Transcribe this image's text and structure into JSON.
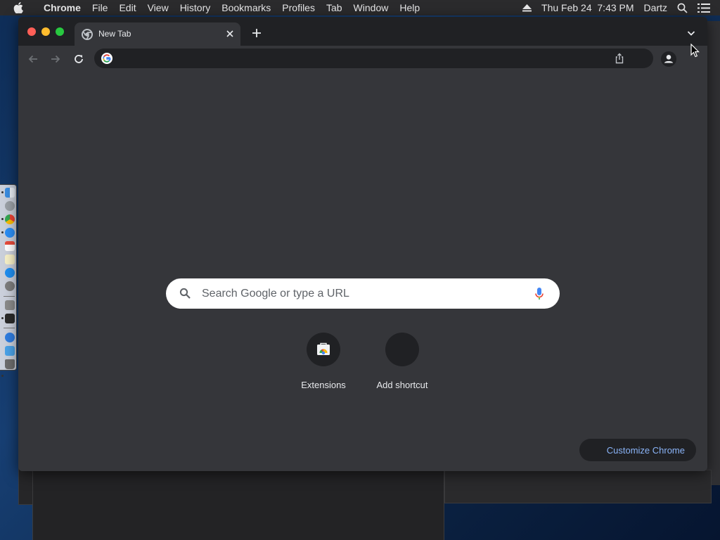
{
  "menubar": {
    "apple": "apple-icon",
    "app_name": "Chrome",
    "items": [
      "File",
      "Edit",
      "View",
      "History",
      "Bookmarks",
      "Profiles",
      "Tab",
      "Window",
      "Help"
    ],
    "datetime": "Thu Feb 24  7:43 PM",
    "user": "Dartz",
    "icons": [
      "eject-icon",
      "spotlight-search-icon",
      "control-center-icon"
    ]
  },
  "browser": {
    "tab": {
      "title": "New Tab",
      "favicon": "chrome-icon"
    },
    "omnibox": {
      "value": "",
      "placeholder": ""
    }
  },
  "ntp": {
    "search_placeholder": "Search Google or type a URL",
    "shortcuts": [
      {
        "label": "Extensions",
        "icon": "web-store-icon"
      },
      {
        "label": "Add shortcut",
        "icon": "plus-icon"
      }
    ],
    "customize_label": "Customize Chrome"
  },
  "colors": {
    "background": "#35363a",
    "tabstrip": "#202124",
    "accent_link": "#8ab4f8"
  }
}
